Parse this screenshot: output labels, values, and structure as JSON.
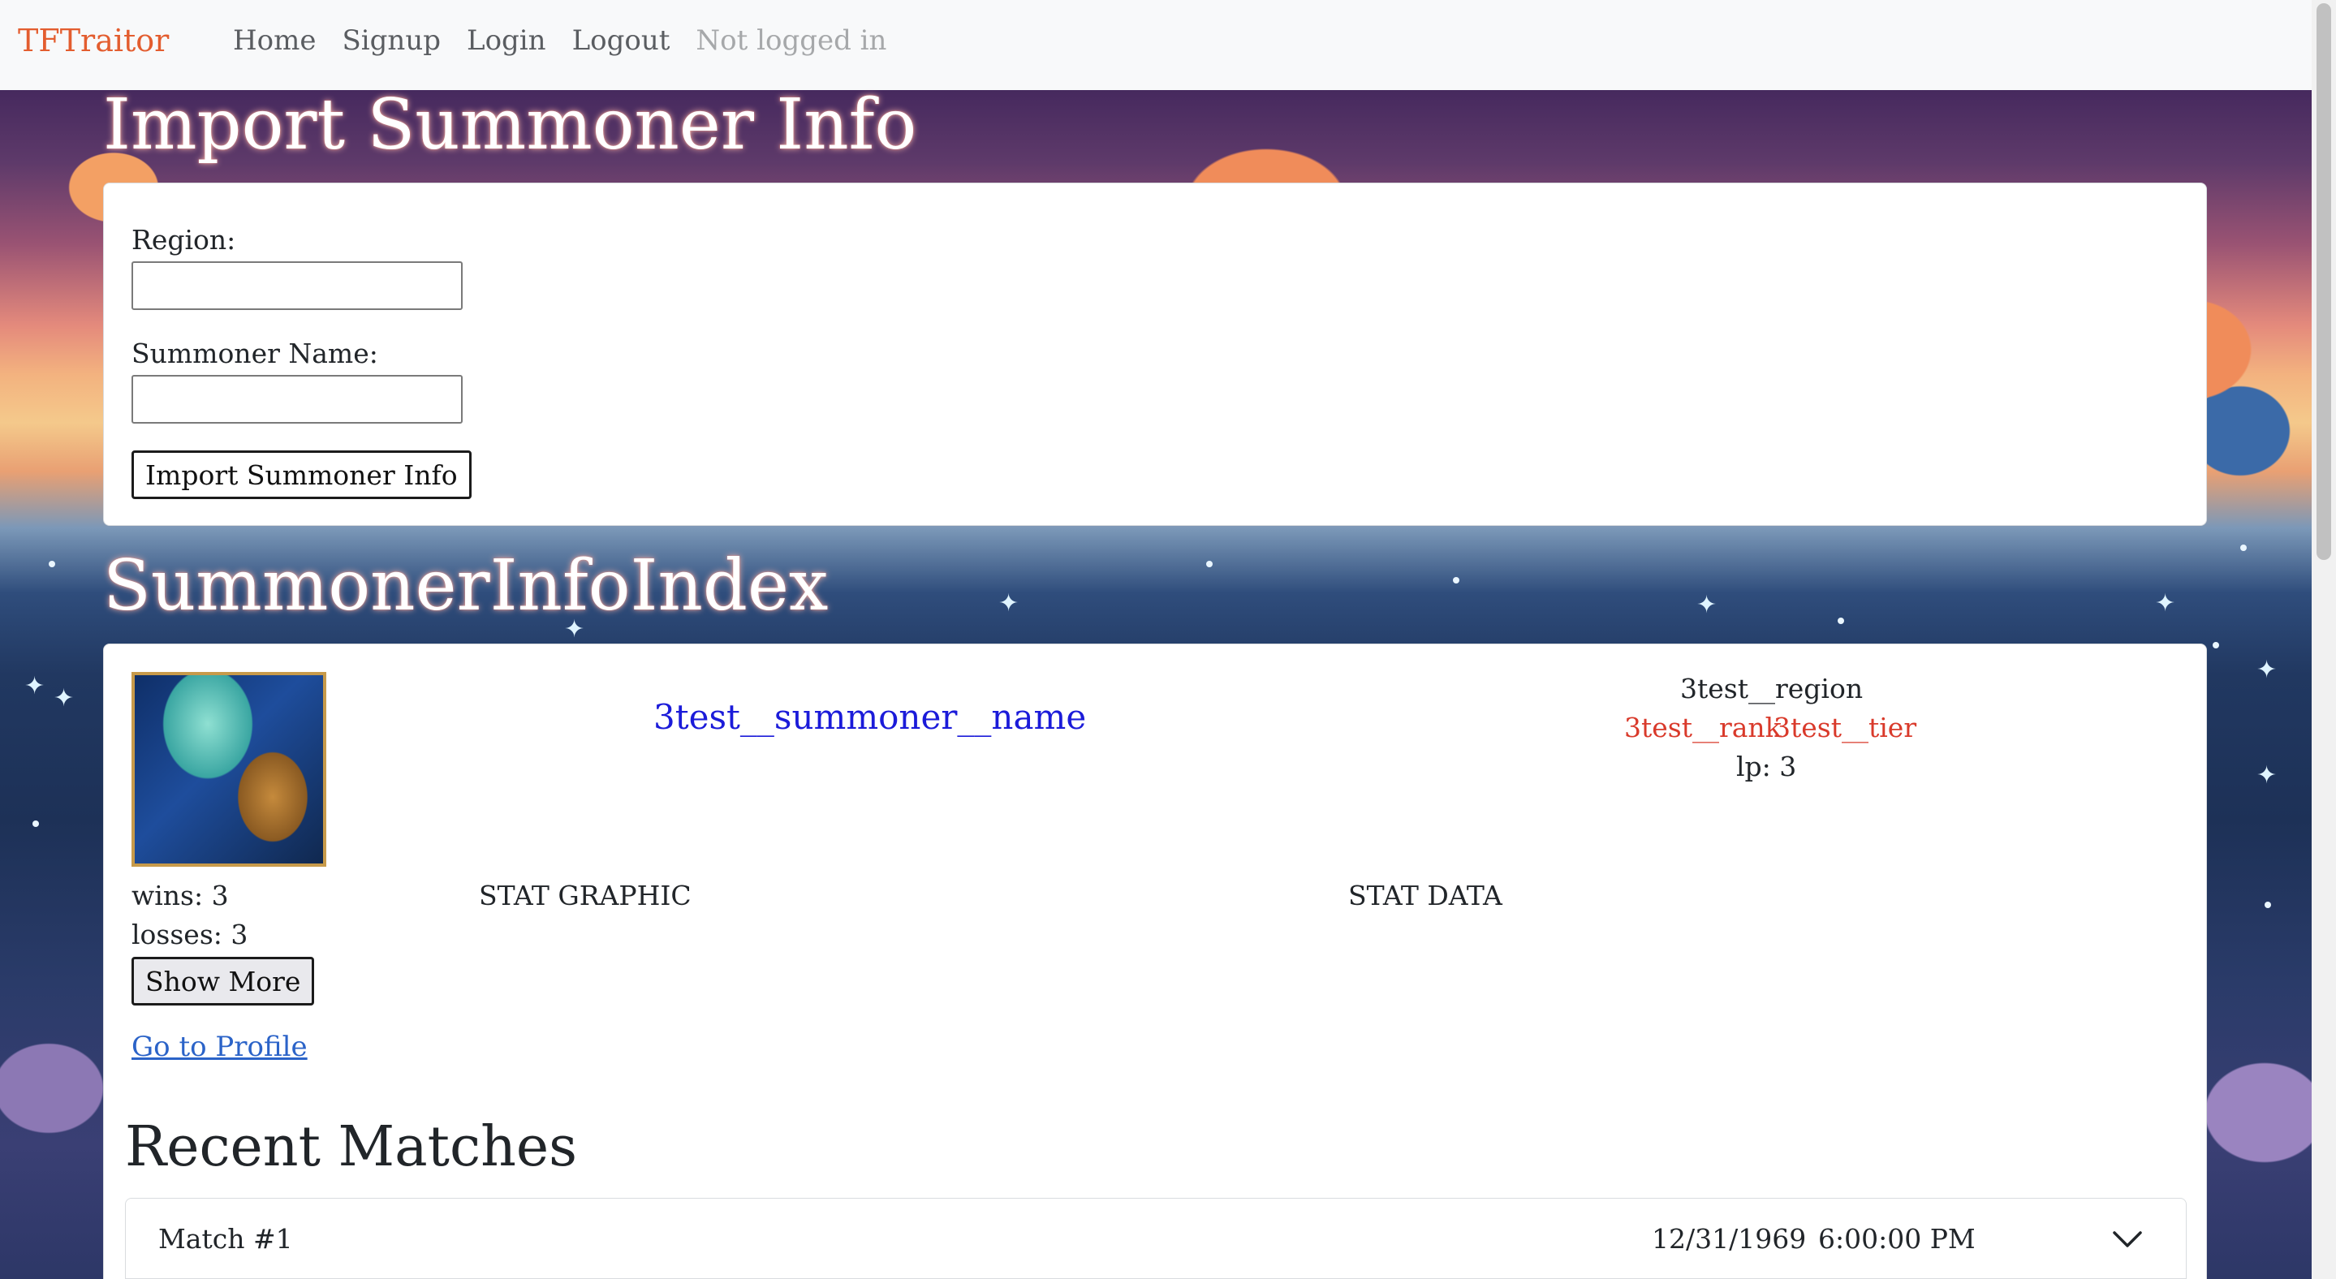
{
  "nav": {
    "brand": "TFTraitor",
    "links": [
      "Home",
      "Signup",
      "Login",
      "Logout"
    ],
    "status": "Not logged in"
  },
  "import_section": {
    "title": "Import Summoner Info",
    "region_label": "Region:",
    "region_value": "",
    "summoner_label": "Summoner Name:",
    "summoner_value": "",
    "submit_label": "Import Summoner Info"
  },
  "index_section": {
    "title": "SummonerInfoIndex"
  },
  "summoner": {
    "name": "3test__summoner__name",
    "region": "3test__region",
    "rank": "3test__rank",
    "tier": "3test__tier",
    "lp": "lp: 3",
    "wins": "wins: 3",
    "losses": "losses: 3",
    "show_more": "Show More",
    "stat_graphic": "STAT GRAPHIC",
    "stat_data": "STAT DATA",
    "profile_link": "Go to Profile"
  },
  "recent_matches": {
    "title": "Recent Matches",
    "matches": [
      {
        "label": "Match #1",
        "date": "12/31/1969",
        "time": "6:00:00 PM"
      }
    ]
  },
  "colors": {
    "brand": "#e35d2f",
    "rank": "#d93a2b",
    "summoner_link": "#1b1bd9",
    "profile_link": "#2b63c8"
  }
}
